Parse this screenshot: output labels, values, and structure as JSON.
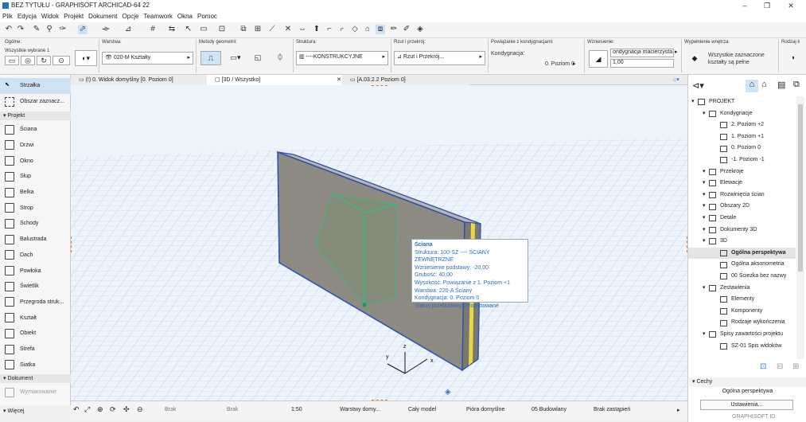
{
  "window": {
    "title": "BEZ TYTUŁU - GRAPHISOFT ARCHICAD-64 22"
  },
  "menu": [
    "Plik",
    "Edycja",
    "Widok",
    "Projekt",
    "Dokument",
    "Opcje",
    "Teamwork",
    "Okna",
    "Pomoc"
  ],
  "infobox": {
    "general_label": "Ogólne:",
    "all_selected": "Wszystkie wybrane 1",
    "layer_label": "Warstwa:",
    "layer_value": "020-M Kształty",
    "geom_label": "Metody geometrii:",
    "struct_label": "Struktura:",
    "struct_value": "----KONSTRUKCYJNE",
    "cut_label": "Rzut i przekrój:",
    "cut_value": "Rzut i Przekrój...",
    "link_label": "Powiązanie z kondygnacjami:",
    "story_label": "Kondygnacja:",
    "story_value": "0. Poziom 0",
    "elev_label": "Wzniesienie:",
    "elev_field": "ondygnacja macierzysta",
    "elev_value": "1,00",
    "fill_label": "Wypełnienie wnętrza:",
    "fill_value1": "Wszystkie zaznaczone",
    "fill_value2": "kształty są pełne",
    "frame_label": "Rodzaj k"
  },
  "toolbox": {
    "arrow": "Strzałka",
    "marquee": "Obszar zaznacz...",
    "section_project": "Projekt",
    "tools": [
      "Ściana",
      "Drzwi",
      "Okno",
      "Słup",
      "Belka",
      "Strop",
      "Schody",
      "Balustrada",
      "Dach",
      "Powłoka",
      "Świetlik",
      "Przegroda struk...",
      "Kształt",
      "Obiekt",
      "Strefa",
      "Siatka"
    ],
    "section_document": "Dokument",
    "dim_tool": "Wymiarowanie",
    "more": "Więcej"
  },
  "tabs": [
    "(!) 0. Widok domyślny [0. Poziom 0]",
    "[3D / Wszystko]",
    "[A.03.2.2 Poziom 0]"
  ],
  "tooltip": {
    "title": "Ściana",
    "lines": [
      "Struktura: 100-SZ ---- ŚCIANY ZEWNĘTRZNE",
      "Wzniesienie podstawy: -20,00",
      "Grubość: 40,00",
      "Wysokość: Powiązanie z 1. Poziom +1",
      "Warstwa: 220-A Ściany",
      "Kondygnacja: 0. Poziom 0",
      "Status przebudowy: Projektowane"
    ]
  },
  "axis": {
    "x": "x",
    "y": "y",
    "z": "z"
  },
  "status": {
    "brak1": "Brak",
    "brak2": "Brak",
    "scale": "1:50",
    "layers": "Warstwy domy...",
    "model": "Cały model",
    "pens": "Pióra domyślne",
    "mvo": "05 Budowlany",
    "override": "Brak zastąpień"
  },
  "nav": {
    "items": [
      {
        "t": "PROJEKT",
        "lvl": 0
      },
      {
        "t": "Kondygnacje",
        "lvl": 1
      },
      {
        "t": "2. Poziom +2",
        "lvl": 2
      },
      {
        "t": "1. Poziom +1",
        "lvl": 2
      },
      {
        "t": "0. Poziom 0",
        "lvl": 2
      },
      {
        "t": "-1. Poziom -1",
        "lvl": 2
      },
      {
        "t": "Przekroje",
        "lvl": 1
      },
      {
        "t": "Elewacje",
        "lvl": 1
      },
      {
        "t": "Rozwinięcia ścian",
        "lvl": 1
      },
      {
        "t": "Obszary 2D",
        "lvl": 1
      },
      {
        "t": "Detale",
        "lvl": 1
      },
      {
        "t": "Dokumenty 3D",
        "lvl": 1
      },
      {
        "t": "3D",
        "lvl": 1
      },
      {
        "t": "Ogólna perspektywa",
        "lvl": 2,
        "sel": true
      },
      {
        "t": "Ogólna aksonometria",
        "lvl": 2
      },
      {
        "t": "00 Ścieżka bez nazwy",
        "lvl": 2
      },
      {
        "t": "Zestawienia",
        "lvl": 1
      },
      {
        "t": "Elementy",
        "lvl": 2
      },
      {
        "t": "Komponenty",
        "lvl": 2
      },
      {
        "t": "Rodzaje wykończenia",
        "lvl": 2
      },
      {
        "t": "Spisy zawartości projektu",
        "lvl": 1
      },
      {
        "t": "SZ-01 Spis widoków",
        "lvl": 2
      }
    ],
    "props_label": "Cechy",
    "props_value": "Ogólna perspektywa",
    "settings": "Ustawienia...",
    "brand": "GRAPHISOFT ID"
  },
  "colors": {
    "accent": "#2b6cc4",
    "wall": "#8d8a82",
    "select": "#2ec27e",
    "core": "#e5d84a"
  }
}
